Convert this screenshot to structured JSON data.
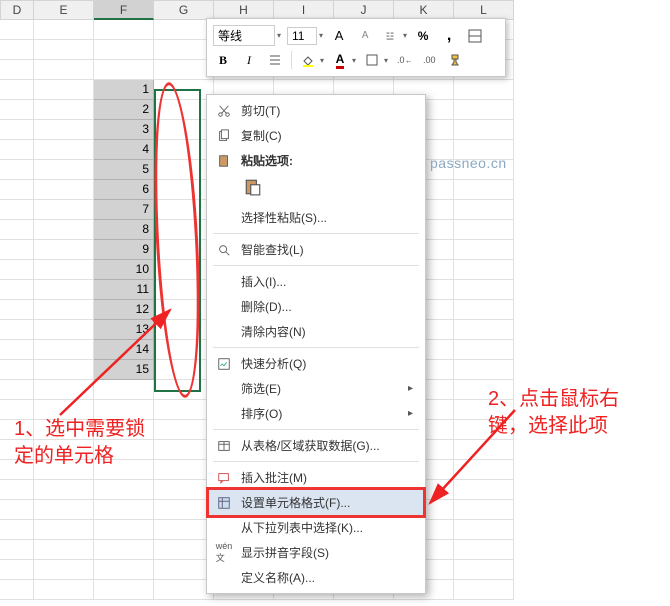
{
  "columns": [
    "D",
    "E",
    "F",
    "G",
    "H",
    "I",
    "J",
    "K",
    "L"
  ],
  "selected_column": "F",
  "selection_values": [
    1,
    2,
    3,
    4,
    5,
    6,
    7,
    8,
    9,
    10,
    11,
    12,
    13,
    14,
    15
  ],
  "mini_toolbar": {
    "font": "等线",
    "size": "11",
    "inc_font": "A",
    "dec_font": "A",
    "percent": "%",
    "comma": ",",
    "btn_bold": "B",
    "btn_italic": "I",
    "font_color": "A"
  },
  "context_menu": {
    "cut": "剪切(T)",
    "copy": "复制(C)",
    "paste_section": "粘贴选项:",
    "paste_special": "选择性粘贴(S)...",
    "smart_lookup": "智能查找(L)",
    "insert": "插入(I)...",
    "delete": "删除(D)...",
    "clear": "清除内容(N)",
    "quick_analysis": "快速分析(Q)",
    "filter": "筛选(E)",
    "sort": "排序(O)",
    "table_range": "从表格/区域获取数据(G)...",
    "insert_comment": "插入批注(M)",
    "format_cells": "设置单元格格式(F)...",
    "pick_dropdown": "从下拉列表中选择(K)...",
    "show_pinyin": "显示拼音字段(S)",
    "define_name": "定义名称(A)..."
  },
  "annotations": {
    "watermark": "passneo.cn",
    "step1": "1、选中需要锁定的单元格",
    "step2": "2、点击鼠标右键，选择此项"
  }
}
